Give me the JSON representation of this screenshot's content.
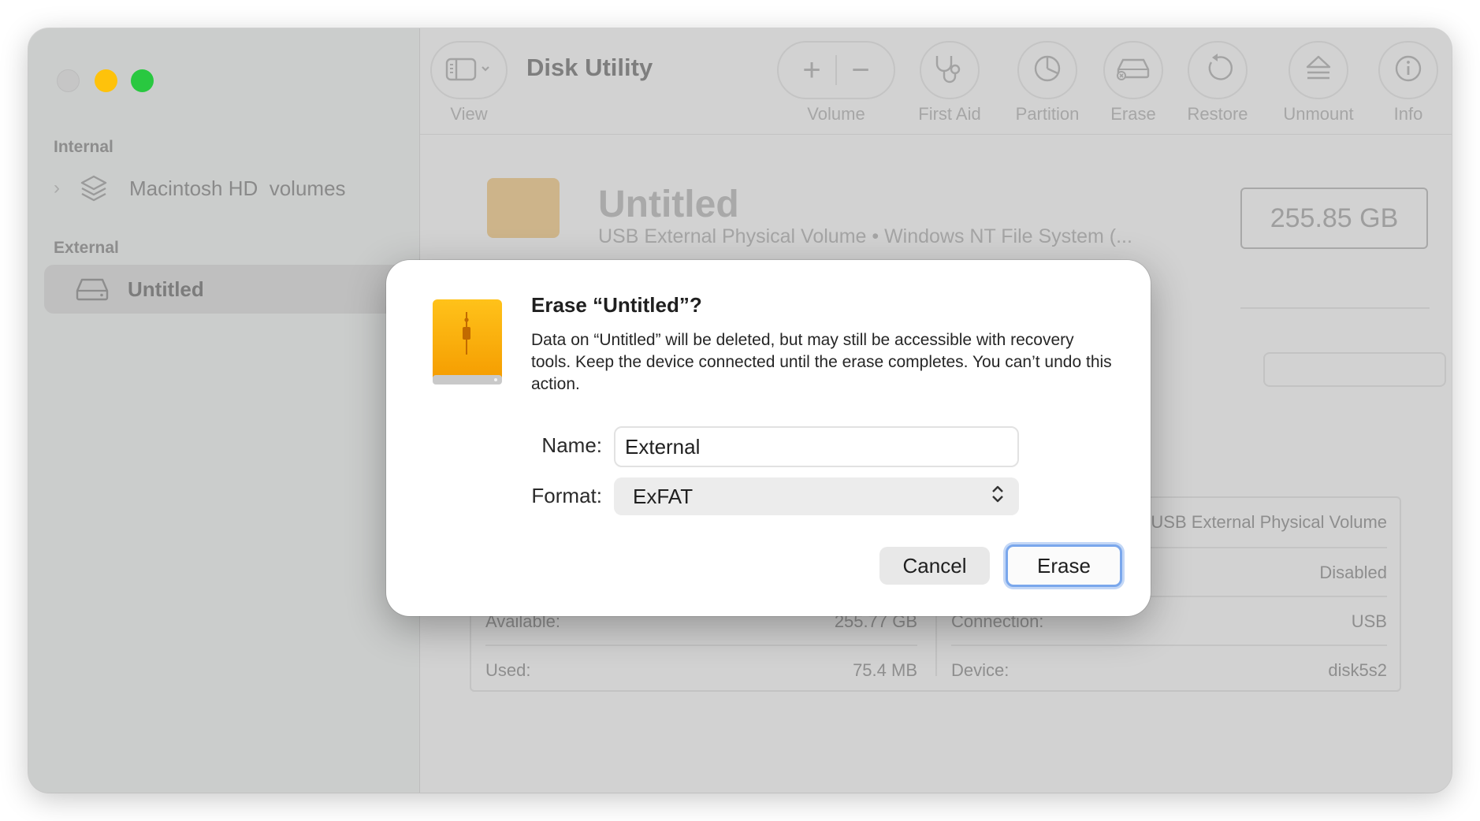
{
  "app": {
    "title": "Disk Utility"
  },
  "toolbar": {
    "view_label": "View",
    "volume_label": "Volume",
    "first_aid_label": "First Aid",
    "partition_label": "Partition",
    "erase_label": "Erase",
    "restore_label": "Restore",
    "unmount_label": "Unmount",
    "info_label": "Info"
  },
  "sidebar": {
    "internal_header": "Internal",
    "internal_item": "Macintosh HD  volumes",
    "external_header": "External",
    "external_item": "Untitled"
  },
  "volume": {
    "name": "Untitled",
    "subtitle": "USB External Physical Volume • Windows NT File System (...",
    "capacity": "255.85 GB"
  },
  "info": {
    "left": [
      {
        "label": "Available:",
        "value": "255.77 GB"
      },
      {
        "label": "Used:",
        "value": "75.4 MB"
      }
    ],
    "right": [
      {
        "label": "",
        "value": "USB External Physical Volume"
      },
      {
        "label": "",
        "value": "Disabled"
      },
      {
        "label": "Connection:",
        "value": "USB"
      },
      {
        "label": "Device:",
        "value": "disk5s2"
      }
    ]
  },
  "dialog": {
    "title": "Erase “Untitled”?",
    "message": "Data on “Untitled” will be deleted, but may still be accessible with recovery tools. Keep the device connected until the erase completes. You can’t undo this action.",
    "name_label": "Name:",
    "name_value": "External",
    "format_label": "Format:",
    "format_value": "ExFAT",
    "cancel_label": "Cancel",
    "erase_label": "Erase"
  },
  "colors": {
    "accent_focus": "#7aa7ec",
    "drive_orange": "#f5a300",
    "traffic_min": "#fec20b",
    "traffic_max": "#29c840"
  }
}
